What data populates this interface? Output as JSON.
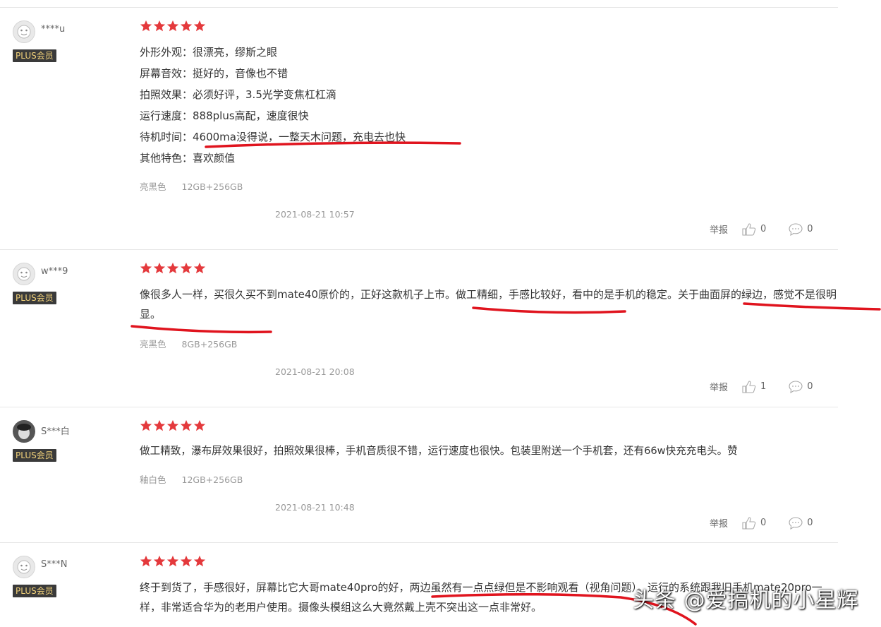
{
  "reviews": [
    {
      "username": "****u",
      "badge": "PLUS会员",
      "lines": [
        "外形外观：很漂亮，缪斯之眼",
        "屏幕音效：挺好的，音像也不错",
        "拍照效果：必须好评，3.5光学变焦杠杠滴",
        "运行速度：888plus高配，速度很快",
        "待机时间：4600ma没得说，一整天木问题，充电去也快",
        "其他特色：喜欢颜值"
      ],
      "color": "亮黑色",
      "spec": "12GB+256GB",
      "date": "2021-08-21 10:57",
      "report": "举报",
      "likes": "0",
      "comments": "0"
    },
    {
      "username": "w***9",
      "badge": "PLUS会员",
      "text": "像很多人一样，买很久买不到mate40原价的，正好这款机子上市。做工精细，手感比较好，看中的是手机的稳定。关于曲面屏的绿边，感觉不是很明显。",
      "color": "亮黑色",
      "spec": "8GB+256GB",
      "date": "2021-08-21 20:08",
      "report": "举报",
      "likes": "1",
      "comments": "0"
    },
    {
      "username": "S***白",
      "badge": "PLUS会员",
      "text": "做工精致，瀑布屏效果很好，拍照效果很棒，手机音质很不错，运行速度也很快。包装里附送一个手机套，还有66w快充充电头。赞",
      "color": "釉白色",
      "spec": "12GB+256GB",
      "date": "2021-08-21 10:48",
      "report": "举报",
      "likes": "0",
      "comments": "0"
    },
    {
      "username": "S***N",
      "badge": "PLUS会员",
      "text": "终于到货了，手感很好，屏幕比它大哥mate40pro的好，两边虽然有一点点绿但是不影响观看（视角问题）。运行的系统跟我旧手机mate20pro一样，非常适合华为的老用户使用。摄像头模组这么大竟然戴上壳不突出这一点非常好。"
    }
  ],
  "watermark": "头条 @爱搞机的小星辉",
  "colors": {
    "star": "#e4393c",
    "badge_bg": "#3a3a3a",
    "badge_text": "#f2d27a",
    "annotation": "#e0141e"
  }
}
